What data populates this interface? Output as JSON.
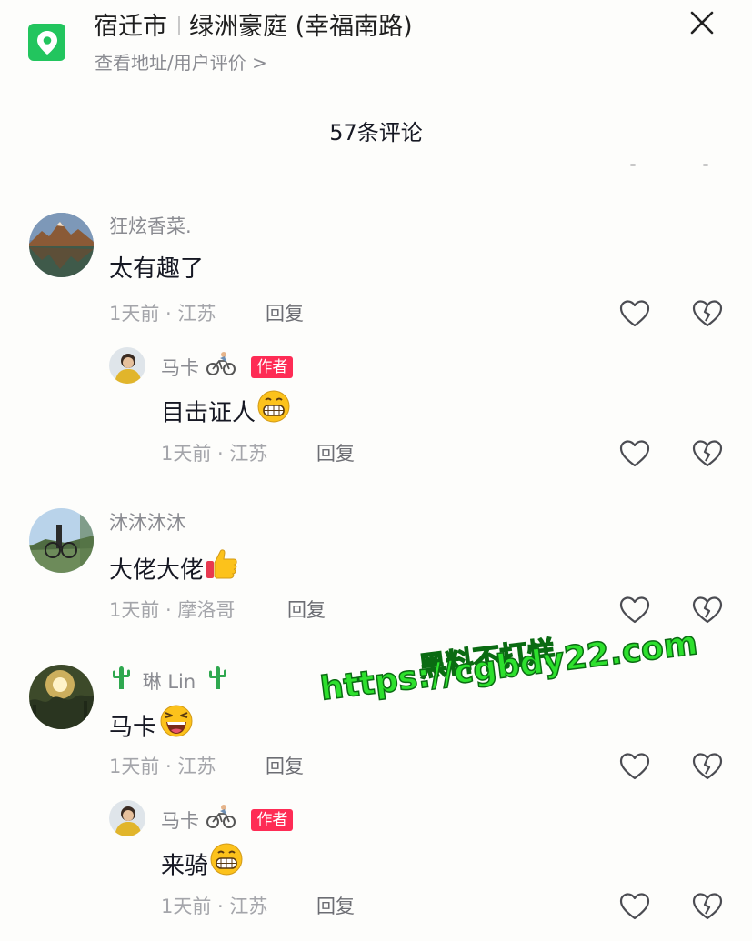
{
  "header": {
    "city": "宿迁市",
    "place": "绿洲豪庭 (幸福南路)",
    "sub": "查看地址/用户评价 >",
    "comment_count": "57条评论"
  },
  "colors": {
    "accent_green": "#22c55e",
    "author_badge": "#fe2c55",
    "watermark": "#2de02d"
  },
  "comments": [
    {
      "name": "狂炫香菜.",
      "text": "太有趣了",
      "meta": "1天前 · 江苏",
      "reply": "回复",
      "avatar": "mountain-lake-avatar",
      "replies": [
        {
          "name": "马卡",
          "name_emoji": "cyclist-emoji",
          "badge": "作者",
          "text": "目击证人",
          "text_emoji": "grinning-face-emoji",
          "meta": "1天前 · 江苏",
          "reply": "回复"
        }
      ]
    },
    {
      "name": "沐沐沐沐",
      "text": "大佬大佬",
      "text_emoji": "thumbs-up-emoji",
      "meta": "1天前 · 摩洛哥",
      "reply": "回复",
      "avatar": "cyclist-photo-avatar"
    },
    {
      "name": "琳 Lin",
      "name_prefix_emoji": "cactus-emoji",
      "name_suffix_emoji": "cactus-emoji",
      "text": "马卡",
      "text_emoji": "laughing-face-emoji",
      "meta": "1天前 · 江苏",
      "reply": "回复",
      "avatar": "sunset-trees-avatar",
      "replies": [
        {
          "name": "马卡",
          "name_emoji": "cyclist-emoji",
          "badge": "作者",
          "text": "来骑",
          "text_emoji": "grinning-face-emoji",
          "meta": "1天前 · 江苏",
          "reply": "回复"
        }
      ]
    }
  ],
  "watermark": {
    "line1": "黑料不打烊",
    "line2": "https://cgbdy22.com"
  }
}
